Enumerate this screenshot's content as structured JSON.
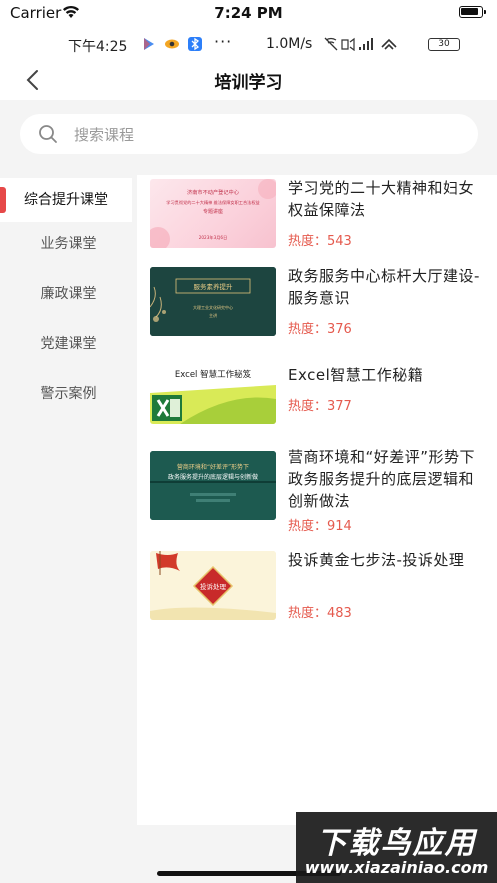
{
  "ios_status": {
    "carrier": "Carrier",
    "time": "7:24 PM"
  },
  "android_status": {
    "time": "下午4:25",
    "dots": "···",
    "speed": "1.0M/s",
    "battery": "30"
  },
  "header": {
    "title": "培训学习"
  },
  "search": {
    "placeholder": "搜索课程"
  },
  "sidebar": {
    "items": [
      {
        "label": "综合提升课堂",
        "active": true
      },
      {
        "label": "业务课堂"
      },
      {
        "label": "廉政课堂"
      },
      {
        "label": "党建课堂"
      },
      {
        "label": "警示案例"
      }
    ]
  },
  "courses": [
    {
      "title": "学习党的二十大精神和妇女权益保障法",
      "heat": "热度：543",
      "thumb_text": [
        "济南市不动产登记中心",
        "学习贯彻党的二十大精神 维法保障女职工合法权益",
        "专题讲座",
        "2023年3月6日"
      ]
    },
    {
      "title": "政务服务中心标杆大厅建设-服务意识",
      "heat": "热度：376",
      "thumb_text": [
        "服务素养提升",
        "大理工业文化研究中心",
        "主讲"
      ]
    },
    {
      "title": "Excel智慧工作秘籍",
      "heat": "热度：377",
      "thumb_text": [
        "Excel 智慧工作秘笈"
      ]
    },
    {
      "title": "营商环境和“好差评”形势下政务服务提升的底层逻辑和创新做法",
      "heat": "热度：914",
      "thumb_text": [
        "营商环境和“好差评”形势下",
        "政务服务提升的底层逻辑与创新做"
      ]
    },
    {
      "title": "投诉黄金七步法-投诉处理",
      "heat": "热度：483",
      "thumb_text": [
        "投诉处理"
      ]
    }
  ],
  "watermark": {
    "title": "下载鸟应用",
    "url": "www.xiazainiao.com"
  },
  "colors": {
    "accent": "#e64848",
    "heat": "#e55a4e",
    "bg": "#f4f4f4"
  }
}
